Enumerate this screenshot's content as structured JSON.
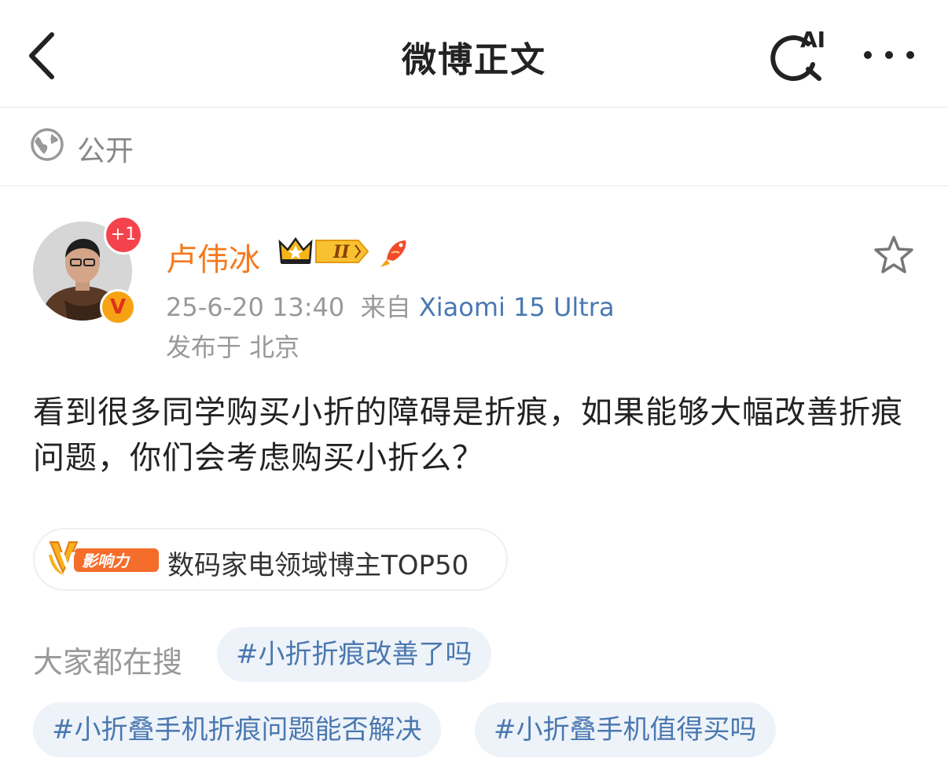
{
  "nav": {
    "title": "微博正文",
    "ai_badge": "AI",
    "icons": {
      "back": "chevron-left-icon",
      "ai_search": "ai-search-icon",
      "more": "more-dots-icon"
    }
  },
  "visibility": {
    "label": "公开",
    "icon": "globe-icon"
  },
  "author": {
    "name": "卢伟冰",
    "name_color": "#f7791c",
    "plus_badge": "+1",
    "verify_mark": "V",
    "crown_level": "II",
    "timestamp": "25-6-20 13:40",
    "source_prefix": "来自",
    "device": "Xiaomi 15 Ultra",
    "location": "发布于 北京"
  },
  "post": {
    "text": "看到很多同学购买小折的障碍是折痕，如果能够大幅改善折痕问题，你们会考虑购买小折么？"
  },
  "influence": {
    "badge_text": "影响力",
    "badge_letter": "V",
    "label": "数码家电领域博主TOP50"
  },
  "hot_search": {
    "label": "大家都在搜",
    "chips": [
      "#小折折痕改善了吗",
      "#小折叠手机折痕问题能否解决",
      "#小折叠手机值得买吗"
    ]
  },
  "colors": {
    "link": "#4a78b0",
    "chip_bg": "#eef3f9",
    "badge_red": "#f5434d",
    "verify_yellow": "#f6a313"
  }
}
